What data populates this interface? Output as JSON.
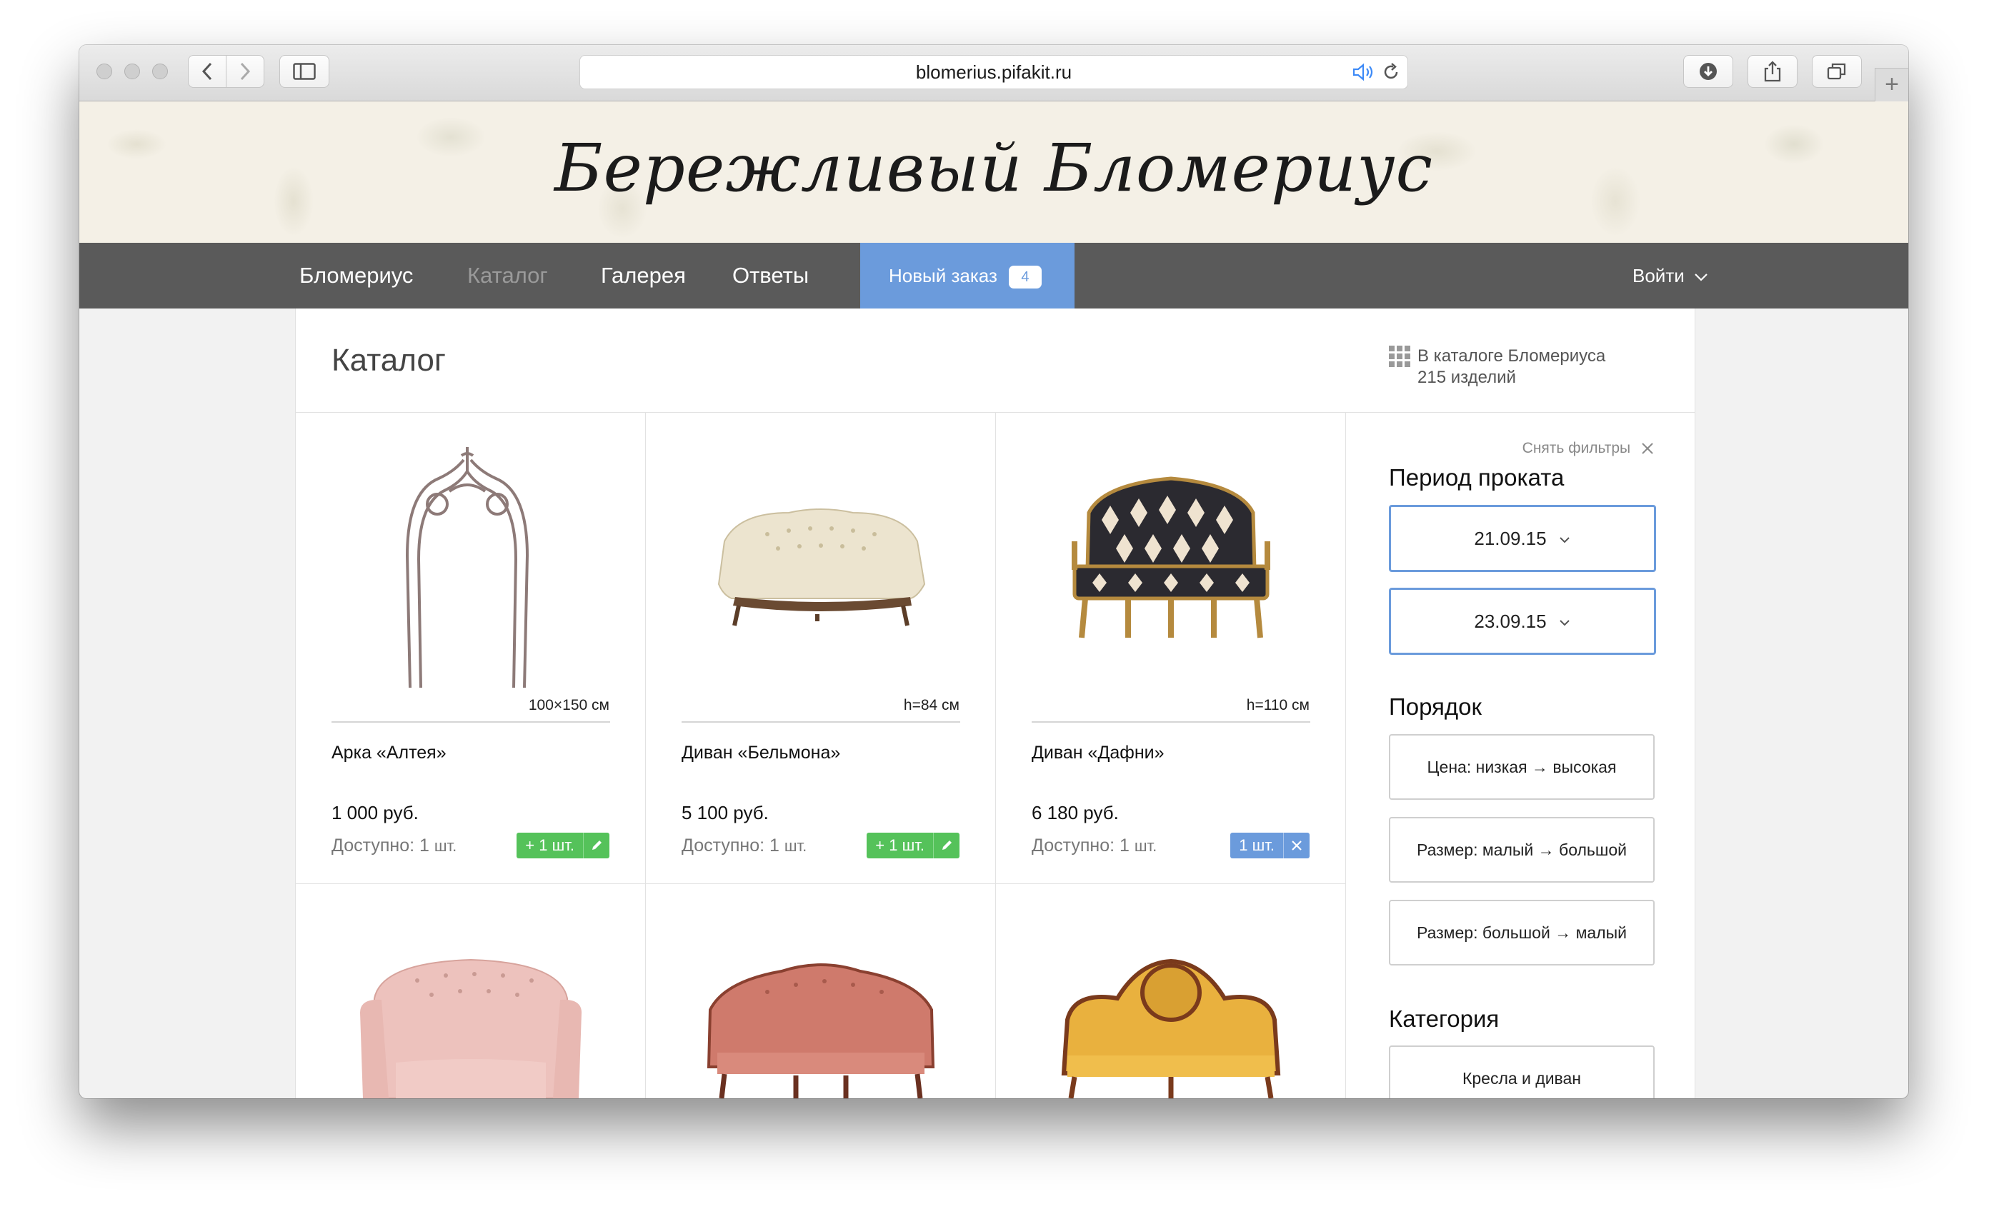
{
  "browser": {
    "url": "blomerius.pifakit.ru",
    "icons": [
      "back-icon",
      "forward-icon",
      "sidebar-icon",
      "speaker-icon",
      "reload-icon",
      "download-icon",
      "share-icon",
      "tabs-icon",
      "new-tab-icon"
    ]
  },
  "site": {
    "logo": "Бережливый Бломериус"
  },
  "nav": {
    "items": [
      "Бломериус",
      "Каталог",
      "Галерея",
      "Ответы"
    ],
    "order_label": "Новый заказ",
    "order_count": "4",
    "login": "Войти"
  },
  "catalog": {
    "title": "Каталог",
    "stats_line1": "В каталоге Бломериуса",
    "stats_line2": "215 изделий"
  },
  "products": [
    {
      "name": "Арка «Алтея»",
      "dim": "100×150 см",
      "price": "1 000 руб.",
      "avail": "Доступно: 1",
      "unit": "шт.",
      "btn": "+ 1 шт.",
      "state": "add"
    },
    {
      "name": "Диван «Бельмона»",
      "dim": "h=84 см",
      "price": "5 100 руб.",
      "avail": "Доступно: 1",
      "unit": "шт.",
      "btn": "+ 1 шт.",
      "state": "add"
    },
    {
      "name": "Диван «Дафни»",
      "dim": "h=110 см",
      "price": "6 180 руб.",
      "avail": "Доступно: 1",
      "unit": "шт.",
      "btn": "1 шт.",
      "state": "added"
    }
  ],
  "filters": {
    "reset": "Снять фильтры",
    "period_title": "Период проката",
    "date_from": "21.09.15",
    "date_to": "23.09.15",
    "order_title": "Порядок",
    "sort_options": [
      "Цена: низкая → высокая",
      "Размер: малый → большой",
      "Размер: большой → малый"
    ],
    "category_title": "Категория",
    "category_first": "Кресла и диван"
  },
  "colors": {
    "accent": "#6b9bdc",
    "add_green": "#55c25a",
    "nav_bg": "#5a5a5a"
  }
}
